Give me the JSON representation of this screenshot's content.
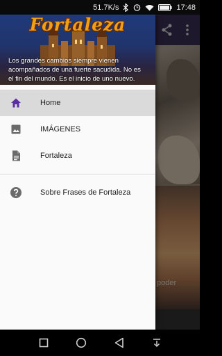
{
  "status_bar": {
    "net_speed": "51.7K/s",
    "time": "17:48",
    "icons": [
      "bluetooth-icon",
      "alarm-icon",
      "wifi-icon",
      "battery-icon"
    ]
  },
  "drawer": {
    "logo_text": "Fortaleza",
    "quote_lines": [
      "Los grandes cambios siempre vienen",
      "acompañados de una fuerte sacudida. No es",
      "el fin del mundo. Es el inicio de uno nuevo."
    ],
    "menu": [
      {
        "label": "Home",
        "icon": "home-icon",
        "active": true
      },
      {
        "label": "IMÁGENES",
        "icon": "image-icon",
        "active": false
      },
      {
        "label": "Fortaleza",
        "icon": "document-icon",
        "active": false
      }
    ],
    "secondary_menu": [
      {
        "label": "Sobre Frases de Fortaleza",
        "icon": "help-icon"
      }
    ]
  },
  "background": {
    "toolbar_icons": [
      "share-icon",
      "more-vert-icon"
    ],
    "caption": "poder"
  },
  "nav_bar": {
    "icons": [
      "recents-icon",
      "home-circle-icon",
      "back-icon",
      "notification-pull-icon"
    ]
  },
  "colors": {
    "accent": "#5b2fa0",
    "drawer_bg": "#fafafa",
    "active_item_bg": "#dadada",
    "logo": "#f0a018"
  }
}
